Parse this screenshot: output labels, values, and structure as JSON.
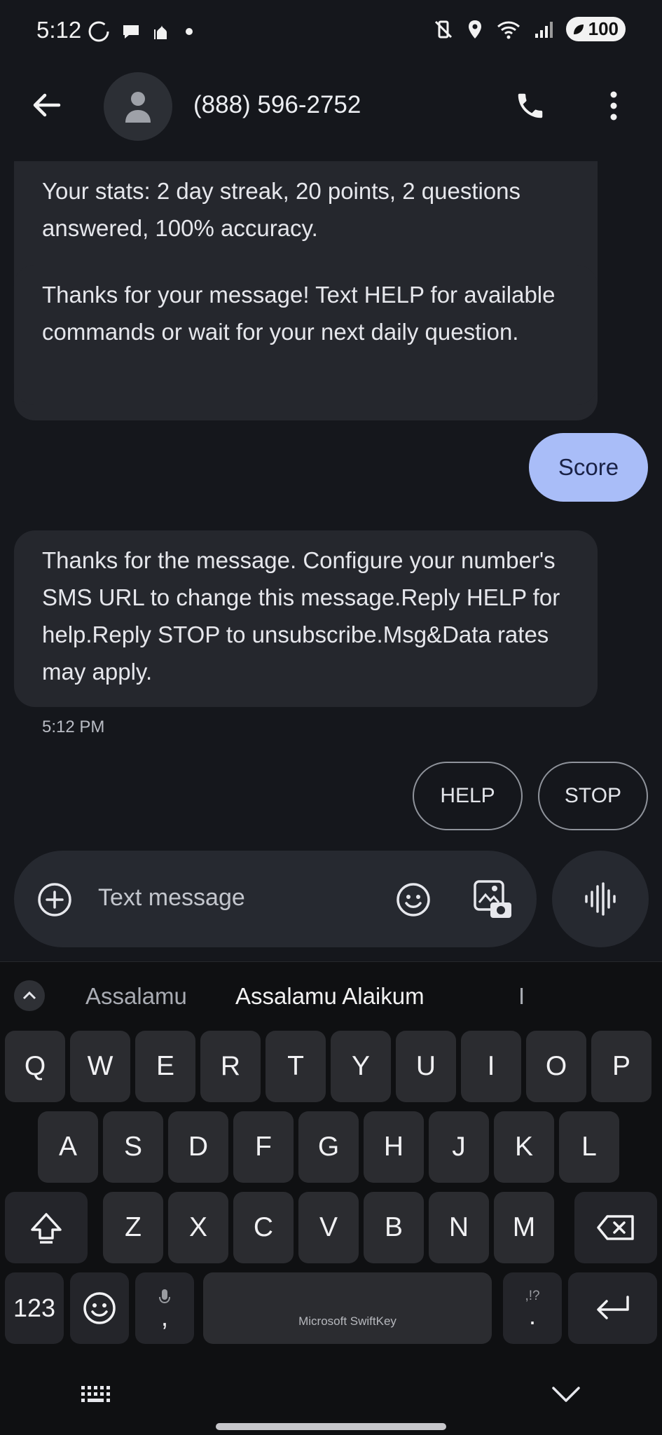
{
  "status_bar": {
    "time": "5:12",
    "battery": "100"
  },
  "app_bar": {
    "contact": "(888) 596-2752"
  },
  "messages": [
    {
      "direction": "incoming",
      "text_partial": "Your stats: 2 day streak, 20 points, 2 questions answered, 100% accuracy."
    },
    {
      "direction": "incoming",
      "text": "Thanks for your message! Text HELP for available commands or wait for your next daily question."
    },
    {
      "direction": "outgoing",
      "text": "Score"
    },
    {
      "direction": "incoming",
      "text": "Thanks for the message. Configure your number's SMS URL to change this message.Reply HELP for help.Reply STOP to unsubscribe.Msg&Data rates may apply."
    }
  ],
  "timestamp": "5:12 PM",
  "smart_replies": [
    "HELP",
    "STOP"
  ],
  "compose": {
    "placeholder": "Text message"
  },
  "keyboard": {
    "suggestions": [
      "Assalamu",
      "Assalamu Alaikum",
      "I"
    ],
    "row1": [
      "Q",
      "W",
      "E",
      "R",
      "T",
      "Y",
      "U",
      "I",
      "O",
      "P"
    ],
    "row2": [
      "A",
      "S",
      "D",
      "F",
      "G",
      "H",
      "J",
      "K",
      "L"
    ],
    "row3": [
      "Z",
      "X",
      "C",
      "V",
      "B",
      "N",
      "M"
    ],
    "numbers_key": "123",
    "comma_key": ",",
    "period_key": ".",
    "period_alt": ",!?",
    "space_label": "Microsoft SwiftKey"
  }
}
